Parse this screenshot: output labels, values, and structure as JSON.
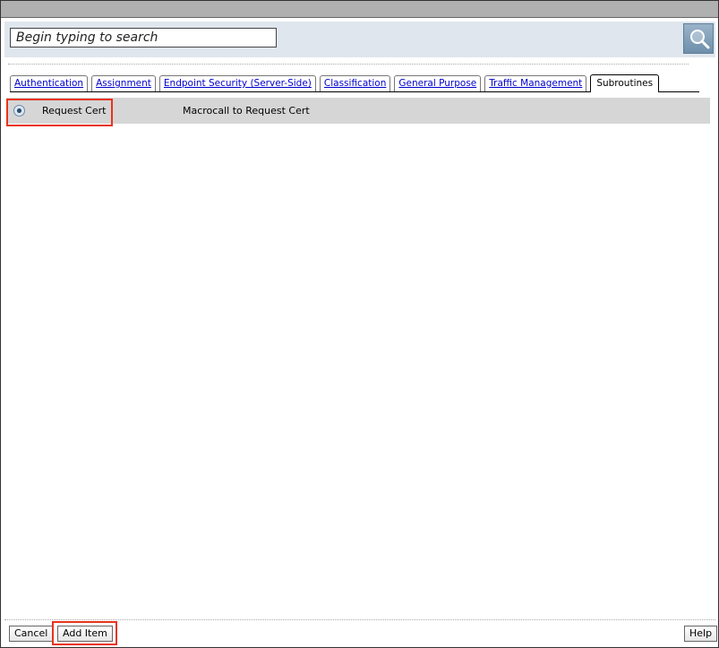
{
  "search": {
    "placeholder": "Begin typing to search",
    "button_icon": "magnifier-icon"
  },
  "tabs": [
    {
      "label": "Authentication",
      "active": false
    },
    {
      "label": "Assignment",
      "active": false
    },
    {
      "label": "Endpoint Security (Server-Side)",
      "active": false
    },
    {
      "label": "Classification",
      "active": false
    },
    {
      "label": "General Purpose",
      "active": false
    },
    {
      "label": "Traffic Management",
      "active": false
    },
    {
      "label": "Subroutines",
      "active": true
    }
  ],
  "items": [
    {
      "name": "Request Cert",
      "description": "Macrocall to Request Cert",
      "selected": true
    }
  ],
  "footer": {
    "cancel_label": "Cancel",
    "add_label": "Add Item",
    "help_label": "Help"
  },
  "colors": {
    "highlight": "#e8341c",
    "search_bg": "#dfe6ed",
    "tab_link": "#0000cc"
  }
}
